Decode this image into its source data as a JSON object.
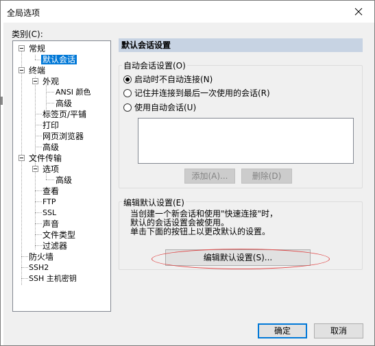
{
  "window": {
    "title": "全局选项"
  },
  "category_label": "类别(C):",
  "tree": {
    "items": [
      {
        "label": "常规"
      },
      {
        "label": "默认会话"
      },
      {
        "label": "终端"
      },
      {
        "label": "外观"
      },
      {
        "label": "ANSI 颜色"
      },
      {
        "label": "高级"
      },
      {
        "label": "标签页/平铺"
      },
      {
        "label": "打印"
      },
      {
        "label": "网页浏览器"
      },
      {
        "label": "高级"
      },
      {
        "label": "文件传输"
      },
      {
        "label": "选项"
      },
      {
        "label": "高级"
      },
      {
        "label": "查看"
      },
      {
        "label": "FTP"
      },
      {
        "label": "SSL"
      },
      {
        "label": "声音"
      },
      {
        "label": "文件类型"
      },
      {
        "label": "过滤器"
      },
      {
        "label": "防火墙"
      },
      {
        "label": "SSH2"
      },
      {
        "label": "SSH 主机密钥"
      }
    ],
    "selected": "默认会话"
  },
  "panel": {
    "title": "默认会话设置",
    "auto_session": {
      "label": "自动会话设置(O)",
      "options": [
        {
          "label": "启动时不自动连接(N)",
          "checked": true
        },
        {
          "label": "记住并连接到最后一次使用的会话(R)",
          "checked": false
        },
        {
          "label": "使用自动会话(U)",
          "checked": false
        }
      ],
      "add_button": "添加(A)...",
      "delete_button": "删除(D)"
    },
    "edit_defaults": {
      "label": "编辑默认设置(E)",
      "description": [
        "当创建一个新会话和使用\"快速连接\"时，",
        "默认的会话设置会被使用。",
        "单击下面的按钮上以更改默认的设置。"
      ],
      "button": "编辑默认设置(S)..."
    }
  },
  "footer": {
    "ok": "确定",
    "cancel": "取消"
  },
  "colors": {
    "selection": "#0078d7",
    "panel_header": "#c7d3e3",
    "annotation": "#e04848"
  },
  "icons": {
    "close": "close-icon",
    "tree_expander": "collapse-icon"
  }
}
